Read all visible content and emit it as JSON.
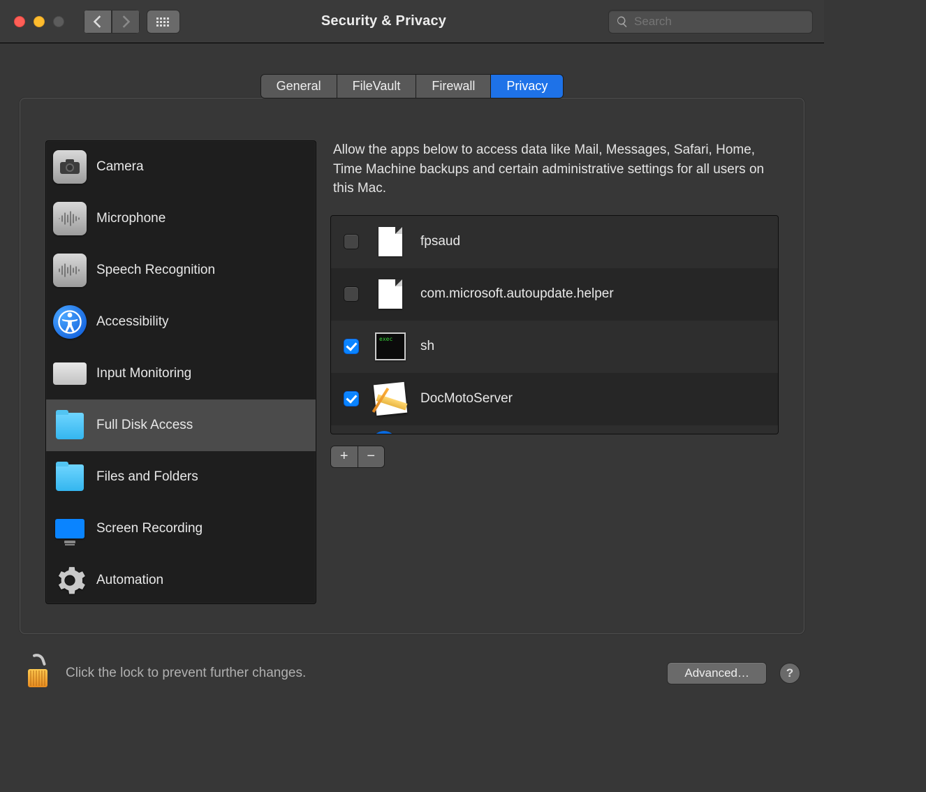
{
  "window": {
    "title": "Security & Privacy"
  },
  "search": {
    "placeholder": "Search"
  },
  "tabs": [
    {
      "label": "General",
      "active": false
    },
    {
      "label": "FileVault",
      "active": false
    },
    {
      "label": "Firewall",
      "active": false
    },
    {
      "label": "Privacy",
      "active": true
    }
  ],
  "sidebar": {
    "items": [
      {
        "label": "Camera",
        "icon": "camera",
        "selected": false
      },
      {
        "label": "Microphone",
        "icon": "microphone",
        "selected": false
      },
      {
        "label": "Speech Recognition",
        "icon": "speech",
        "selected": false
      },
      {
        "label": "Accessibility",
        "icon": "accessibility",
        "selected": false
      },
      {
        "label": "Input Monitoring",
        "icon": "keyboard",
        "selected": false
      },
      {
        "label": "Full Disk Access",
        "icon": "folder",
        "selected": true
      },
      {
        "label": "Files and Folders",
        "icon": "folder",
        "selected": false
      },
      {
        "label": "Screen Recording",
        "icon": "display",
        "selected": false
      },
      {
        "label": "Automation",
        "icon": "gear",
        "selected": false
      }
    ]
  },
  "description": "Allow the apps below to access data like Mail, Messages, Safari, Home, Time Machine backups and certain administrative settings for all users on this Mac.",
  "apps": [
    {
      "name": "fpsaud",
      "checked": false,
      "icon": "document"
    },
    {
      "name": "com.microsoft.autoupdate.helper",
      "checked": false,
      "icon": "document"
    },
    {
      "name": "sh",
      "checked": true,
      "icon": "exec"
    },
    {
      "name": "DocMotoServer",
      "checked": true,
      "icon": "appkit"
    }
  ],
  "footer": {
    "lock_text": "Click the lock to prevent further changes.",
    "advanced_label": "Advanced…",
    "help_label": "?"
  },
  "buttons": {
    "plus": "+",
    "minus": "−"
  },
  "colors": {
    "accent": "#1e72e8",
    "checked": "#0a84ff"
  }
}
